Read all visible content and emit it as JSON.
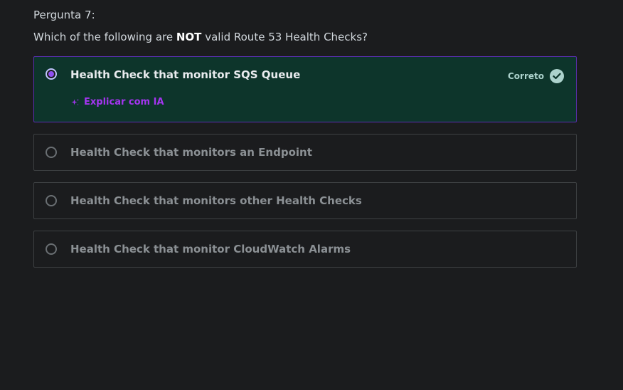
{
  "question": {
    "number_label": "Pergunta 7:",
    "text_before": "Which of the following are ",
    "text_emphasis": "NOT",
    "text_after": " valid Route 53 Health Checks?"
  },
  "options": [
    {
      "label": "Health Check that monitor SQS Queue",
      "selected": true,
      "status": "Correto",
      "explain_label": "Explicar com IA"
    },
    {
      "label": "Health Check that monitors an Endpoint",
      "selected": false
    },
    {
      "label": "Health Check that monitors other Health Checks",
      "selected": false
    },
    {
      "label": "Health Check that monitor CloudWatch Alarms",
      "selected": false
    }
  ],
  "colors": {
    "background": "#1b1c1e",
    "selected_background": "#0d352b",
    "selected_border": "#5a2fb0",
    "accent_purple": "#a435f0",
    "correct_green": "#acd2cc"
  },
  "icons": {
    "correct": "check-circle-icon",
    "explain": "sparkle-icon"
  }
}
